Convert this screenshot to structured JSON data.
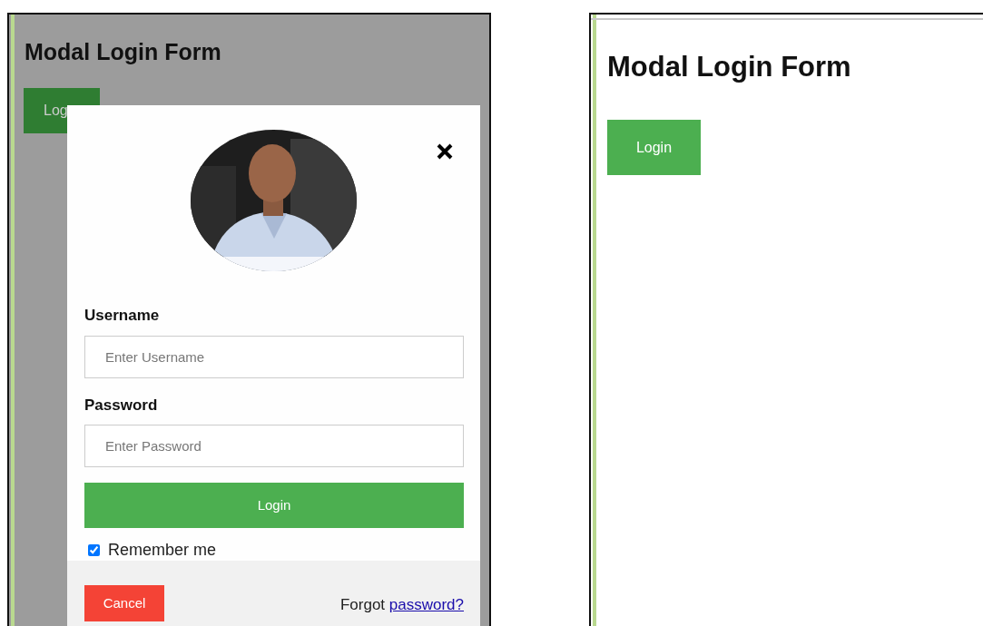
{
  "left_screen": {
    "heading": "Modal Login Form",
    "open_button": "Log",
    "modal": {
      "fields": [
        {
          "label": "Username",
          "placeholder": "Enter Username"
        },
        {
          "label": "Password",
          "placeholder": "Enter Password"
        }
      ],
      "submit": "Login",
      "remember": {
        "label": "Remember me",
        "checked": true
      },
      "cancel": "Cancel",
      "forgot_text": "Forgot",
      "forgot_link": "password?"
    }
  },
  "right_screen": {
    "heading": "Modal Login Form",
    "open_button": "Login"
  }
}
